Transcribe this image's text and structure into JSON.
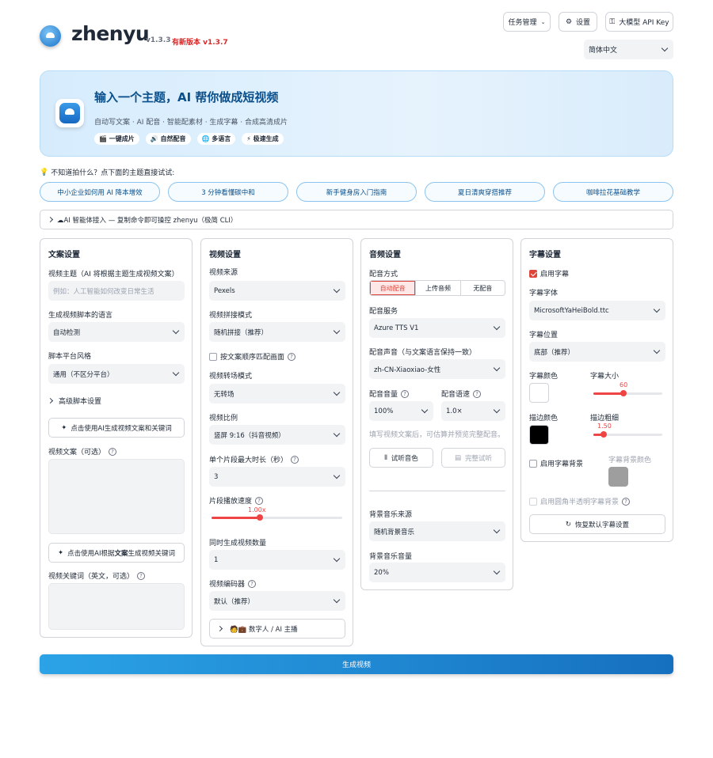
{
  "header": {
    "brand": "zhenyu",
    "version": "v1.3.3",
    "new_version": "有新版本 v1.3.7",
    "task_menu": "任务管理",
    "settings": "设置",
    "api_key": "大模型 API Key",
    "language": "简体中文"
  },
  "hero": {
    "title": "输入一个主题，AI 帮你做成短视频",
    "subtitle": "自动写文案 · AI 配音 · 智能配素材 · 生成字幕 · 合成高清成片",
    "tags": [
      "🎬 一键成片",
      "🔊 自然配音",
      "🌐 多语言",
      "⚡ 极速生成"
    ]
  },
  "hint": "不知道拍什么？点下面的主题直接试试:",
  "topics": [
    "中小企业如何用 AI 降本增效",
    "3 分钟看懂碳中和",
    "新手健身房入门指南",
    "夏日清爽穿搭推荐",
    "咖啡拉花基础教学"
  ],
  "cli": "☁AI 智能体接入 — 复制命令即可操控 zhenyu（极简 CLI）",
  "script_panel": {
    "title": "文案设置",
    "subject_label": "视频主题（AI 将根据主题生成视频文案）",
    "subject_placeholder": "例如：人工智能如何改变日常生活",
    "lang_label": "生成视频脚本的语言",
    "lang_value": "自动检测",
    "style_label": "脚本平台风格",
    "style_value": "通用（不区分平台）",
    "advanced": "高级脚本设置",
    "ai_gen_btn": "点击使用AI生成视频文案和关键词",
    "script_label": "视频文案（可选）",
    "ai_kw_btn_pre": "点击使用AI根据",
    "ai_kw_btn_bold": "文案",
    "ai_kw_btn_post": "生成视频关键词",
    "kw_label": "视频关键词（英文，可选）"
  },
  "video_panel": {
    "title": "视频设置",
    "source_label": "视频来源",
    "source_value": "Pexels",
    "concat_label": "视频拼接模式",
    "concat_value": "随机拼接（推荐）",
    "match_label": "按文案顺序匹配画面",
    "transition_label": "视频转场模式",
    "transition_value": "无转场",
    "ratio_label": "视频比例",
    "ratio_value": "竖屏 9:16（抖音视频）",
    "clip_label": "单个片段最大时长（秒）",
    "clip_value": "3",
    "speed_label": "片段播放速度",
    "speed_value": "1.00x",
    "speed_fraction": 0.37,
    "count_label": "同时生成视频数量",
    "count_value": "1",
    "codec_label": "视频编码器",
    "codec_value": "默认（推荐）",
    "avatar": "🧑💼 数字人 / AI 主播"
  },
  "audio_panel": {
    "title": "音频设置",
    "mode_label": "配音方式",
    "modes": [
      "自动配音",
      "上传音频",
      "无配音"
    ],
    "service_label": "配音服务",
    "service_value": "Azure TTS V1",
    "voice_label": "配音声音（与文案语言保持一致）",
    "voice_value": "zh-CN-Xiaoxiao-女性",
    "volume_label": "配音音量",
    "volume_value": "100%",
    "rate_label": "配音语速",
    "rate_value": "1.0×",
    "tip": "填写视频文案后，可估算并预览完整配音。",
    "try_btn": "试听音色",
    "full_btn": "完整试听",
    "bgm_label": "背景音乐来源",
    "bgm_value": "随机背景音乐",
    "bgm_vol_label": "背景音乐音量",
    "bgm_vol_value": "20%"
  },
  "subtitle_panel": {
    "title": "字幕设置",
    "enable": "启用字幕",
    "font_label": "字幕字体",
    "font_value": "MicrosoftYaHeiBold.ttc",
    "pos_label": "字幕位置",
    "pos_value": "底部（推荐）",
    "color_label": "字幕颜色",
    "size_label": "字幕大小",
    "size_value": "60",
    "size_fraction": 0.44,
    "stroke_color_label": "描边颜色",
    "stroke_label": "描边粗细",
    "stroke_value": "1.50",
    "stroke_fraction": 0.15,
    "bg_enable": "启用字幕背景",
    "bg_color_label": "字幕背景颜色",
    "round_bg": "启用圆角半透明字幕背景",
    "reset_btn": "恢复默认字幕设置",
    "colors": {
      "text": "#ffffff",
      "stroke": "#000000",
      "bg": "#9e9e9e"
    }
  },
  "generate": "生成视频"
}
